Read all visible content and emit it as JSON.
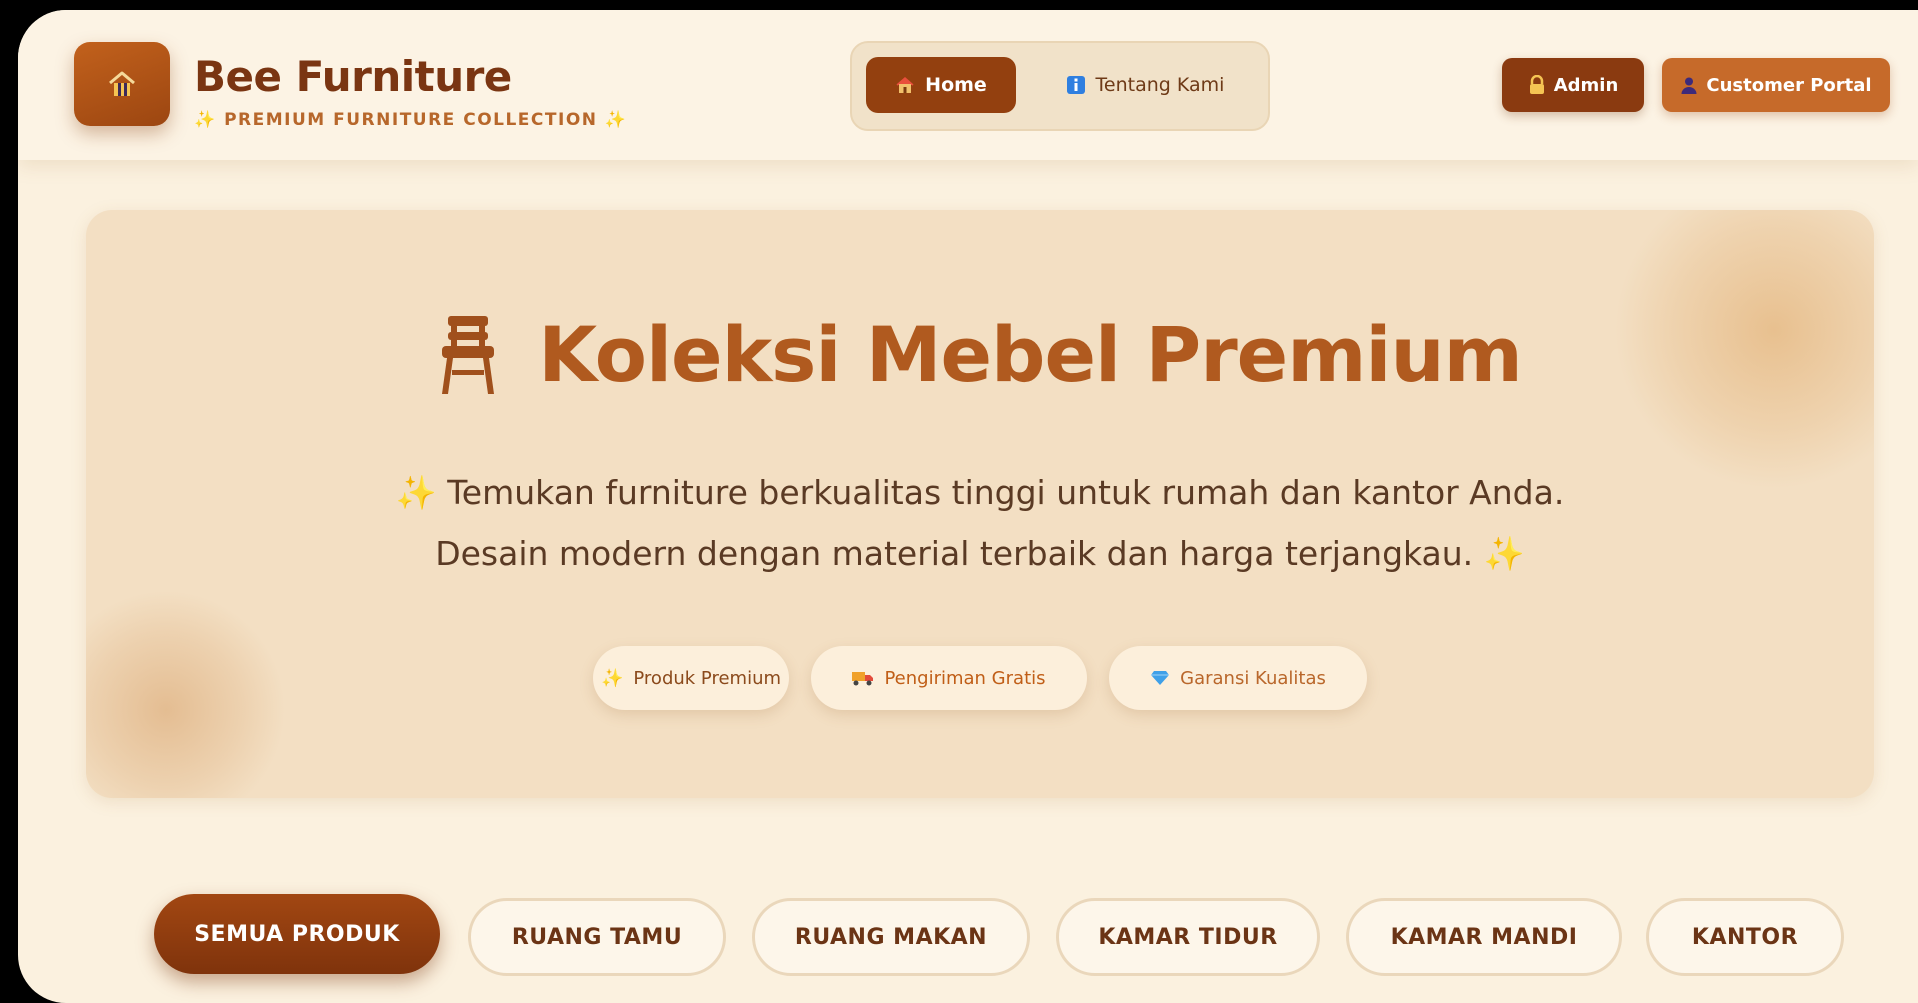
{
  "header": {
    "brand_name": "Bee Furniture",
    "brand_tagline": "✨ PREMIUM FURNITURE COLLECTION ✨",
    "nav": [
      {
        "label": "Home",
        "icon": "house-icon",
        "active": true
      },
      {
        "label": "Tentang Kami",
        "icon": "info-icon",
        "active": false
      }
    ],
    "admin_label": "Admin",
    "portal_label": "Customer Portal"
  },
  "hero": {
    "title": "Koleksi Mebel Premium",
    "subtitle": "Temukan furniture berkualitas tinggi untuk rumah dan kantor Anda. Desain modern dengan material terbaik dan harga terjangkau.",
    "features": [
      {
        "label": "Produk Premium",
        "icon": "sparkles-icon"
      },
      {
        "label": "Pengiriman Gratis",
        "icon": "truck-icon"
      },
      {
        "label": "Garansi Kualitas",
        "icon": "diamond-icon"
      }
    ]
  },
  "categories": [
    {
      "label": "SEMUA PRODUK",
      "active": true
    },
    {
      "label": "RUANG TAMU",
      "active": false
    },
    {
      "label": "RUANG MAKAN",
      "active": false
    },
    {
      "label": "KAMAR TIDUR",
      "active": false
    },
    {
      "label": "KAMAR MANDI",
      "active": false
    },
    {
      "label": "KANTOR",
      "active": false
    }
  ],
  "colors": {
    "primary": "#93400f",
    "accent": "#c66a2a",
    "background": "#fbf1df",
    "hero_bg": "#f3dfc3",
    "title": "#b05a1f"
  }
}
